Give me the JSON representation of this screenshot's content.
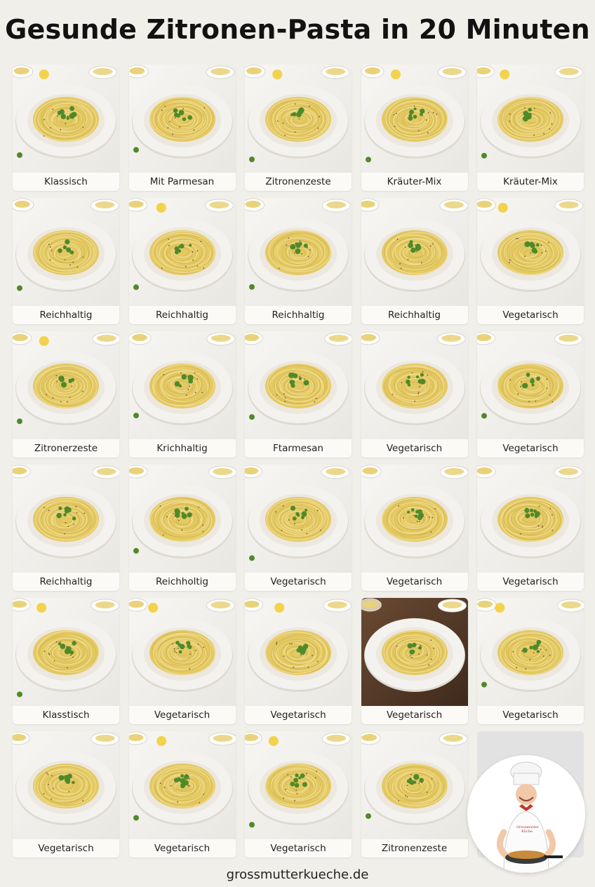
{
  "title": "Gesunde Zitronen-Pasta in 20 Minuten",
  "cards": [
    {
      "label": "Klassisch"
    },
    {
      "label": "Mit Parmesan"
    },
    {
      "label": "Zitronenzeste"
    },
    {
      "label": "Kräuter-Mix"
    },
    {
      "label": "Kräuter-Mix"
    },
    {
      "label": "Reichhaltig"
    },
    {
      "label": "Reichhaltig"
    },
    {
      "label": "Reichhaltig"
    },
    {
      "label": "Reichhaltig"
    },
    {
      "label": "Vegetarisch"
    },
    {
      "label": "Zitronerzeste"
    },
    {
      "label": "Krichhaltig"
    },
    {
      "label": "Ftarmesan"
    },
    {
      "label": "Vegetarisch"
    },
    {
      "label": "Vegetarisch"
    },
    {
      "label": "Reichhaltig"
    },
    {
      "label": "Reichholtig"
    },
    {
      "label": "Vegetarisch"
    },
    {
      "label": "Vegetarisch"
    },
    {
      "label": "Vegetarisch"
    },
    {
      "label": "Klasstisch"
    },
    {
      "label": "Vegetarisch"
    },
    {
      "label": "Vegetarisch"
    },
    {
      "label": "Vegetarisch"
    },
    {
      "label": "Vegetarisch"
    },
    {
      "label": "Vegetarisch"
    },
    {
      "label": "Vegetarisch"
    },
    {
      "label": "Vegetarisch"
    },
    {
      "label": "Zitronenzeste"
    }
  ],
  "chef": {
    "apron_text": "Grossmutter Küche"
  },
  "footer": "grossmutterkueche.de",
  "colors": {
    "background": "#f1efea",
    "pasta": "#e9d27a",
    "herb": "#4f8a2a",
    "lemon": "#f3cf3a",
    "plate": "#f4f2ee"
  }
}
